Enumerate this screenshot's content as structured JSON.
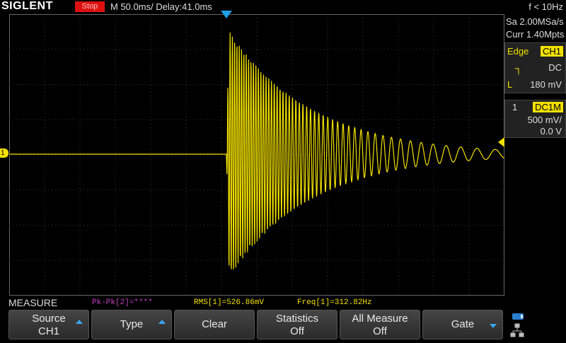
{
  "header": {
    "logo": "SIGLENT",
    "run_state": "Stop",
    "timebase": "M 50.0ms/ Delay:41.0ms",
    "trigger_freq": "f < 10Hz"
  },
  "acquisition": {
    "sample_rate": "Sa 2.00MSa/s",
    "memory_depth": "Curr 1.40Mpts"
  },
  "trigger": {
    "type": "Edge",
    "source": "CH1",
    "coupling": "DC",
    "level_label": "L",
    "level": "180 mV"
  },
  "channel": {
    "number": "1",
    "coupling": "DC1M",
    "scale": "500 mV/",
    "offset": "0.0 V",
    "marker": "1"
  },
  "measure": {
    "title": "MEASURE",
    "items": [
      {
        "text": "Pk-Pk[2]=****",
        "color": "#c040c0"
      },
      {
        "text": "RMS[1]=526.86mV",
        "color": "#f2e000"
      },
      {
        "text": "Freq[1]=312.82Hz",
        "color": "#f2e000"
      }
    ]
  },
  "softkeys": [
    {
      "line1": "Source",
      "line2": "CH1",
      "arrow": "up"
    },
    {
      "line1": "Type",
      "line2": "",
      "arrow": "up"
    },
    {
      "line1": "Clear",
      "line2": "",
      "arrow": ""
    },
    {
      "line1": "Statistics",
      "line2": "Off",
      "arrow": ""
    },
    {
      "line1": "All Measure",
      "line2": "Off",
      "arrow": ""
    },
    {
      "line1": "Gate",
      "line2": "",
      "arrow": "down"
    }
  ],
  "colors": {
    "trace": "#f2e000",
    "trigger_marker": "#1e9fe8",
    "stop_badge": "#e01010",
    "grid": "#3a3a3a"
  },
  "icons": {
    "usb": "usb-icon",
    "network": "network-icon"
  }
}
